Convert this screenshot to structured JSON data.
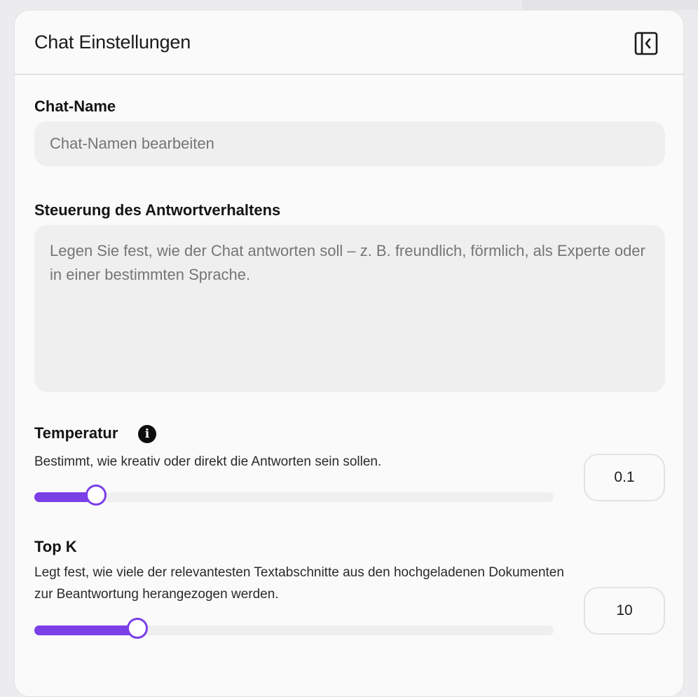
{
  "panel": {
    "title": "Chat Einstellungen",
    "collapse_icon": "sidebar-collapse-icon"
  },
  "chat_name": {
    "label": "Chat-Name",
    "placeholder": "Chat-Namen bearbeiten",
    "value": ""
  },
  "response_control": {
    "label": "Steuerung des Antwortverhaltens",
    "placeholder": "Legen Sie fest, wie der Chat antworten soll – z. B. freundlich, förmlich, als Experte oder in einer bestimmten Sprache.",
    "value": ""
  },
  "temperature": {
    "label": "Temperatur",
    "info_icon": "info-icon",
    "description": "Bestimmt, wie kreativ oder direkt die Antworten sein sollen.",
    "value": "0.1",
    "slider_fraction": 0.119
  },
  "top_k": {
    "label": "Top K",
    "description": "Legt fest, wie viele der relevantesten Textabschnitte aus den hochgeladenen Dokumenten zur Beantwortung herangezogen werden.",
    "value": "10",
    "slider_fraction": 0.198
  },
  "colors": {
    "accent": "#7b3fe8",
    "panel_bg": "#fafafa",
    "field_bg": "#efefef"
  }
}
